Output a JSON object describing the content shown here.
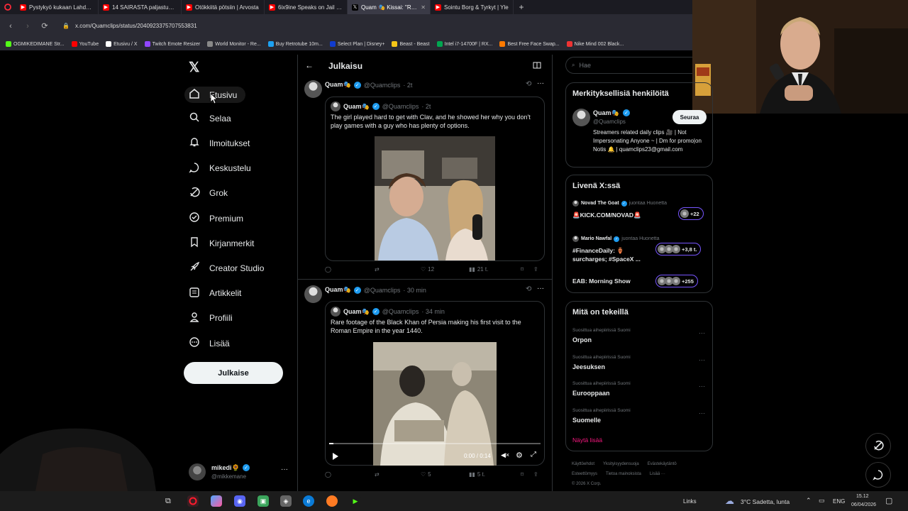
{
  "browser": {
    "tabs": [
      {
        "title": "Pystykyö kukaan Lahdess",
        "color": "#ff0000",
        "icon": "youtube-icon"
      },
      {
        "title": "14 SAIRASTA paljastusta Y",
        "color": "#ff0000",
        "icon": "youtube-icon"
      },
      {
        "title": "Otökkiitä pötsiin | Arvosta",
        "color": "#ff0000",
        "icon": "youtube-icon"
      },
      {
        "title": "6ix9ine Speaks on Jail with",
        "color": "#ff0000",
        "icon": "youtube-icon"
      },
      {
        "title": "Quam 🎭 Kissai: \"Rails",
        "color": "#ffffff",
        "icon": "x-icon"
      },
      {
        "title": "Sointu Borg & Tyrkyt | Yle",
        "color": "#ff0000",
        "icon": "youtube-icon"
      }
    ],
    "url": "x.com/Quamclips/status/2040923375707553831",
    "bookmarks": [
      {
        "label": "OGMIKEDIMANE Str...",
        "color": "#53fc18"
      },
      {
        "label": "YouTube",
        "color": "#ff0000"
      },
      {
        "label": "Etusivu / X",
        "color": "#ffffff"
      },
      {
        "label": "Twitch Emote Resizer",
        "color": "#9146ff"
      },
      {
        "label": "World Monitor - Re...",
        "color": "#888888"
      },
      {
        "label": "Buy Retrotube 10m...",
        "color": "#1da1f2"
      },
      {
        "label": "Select Plan | Disney+",
        "color": "#113ccf"
      },
      {
        "label": "Beast - Beast",
        "color": "#f5c518"
      },
      {
        "label": "Intel i7-14700F | RX...",
        "color": "#00a650"
      },
      {
        "label": "Best Free Face Swap...",
        "color": "#ff7a00"
      },
      {
        "label": "Nike Mind 002 Black...",
        "color": "#ee3333"
      }
    ]
  },
  "nav": {
    "items": [
      {
        "label": "Etusivu",
        "icon": "home-icon"
      },
      {
        "label": "Selaa",
        "icon": "search-icon"
      },
      {
        "label": "Ilmoitukset",
        "icon": "bell-icon"
      },
      {
        "label": "Keskustelu",
        "icon": "chat-icon"
      },
      {
        "label": "Grok",
        "icon": "grok-icon"
      },
      {
        "label": "Premium",
        "icon": "premium-icon"
      },
      {
        "label": "Kirjanmerkit",
        "icon": "bookmark-icon"
      },
      {
        "label": "Creator Studio",
        "icon": "rocket-icon"
      },
      {
        "label": "Artikkelit",
        "icon": "article-icon"
      },
      {
        "label": "Profiili",
        "icon": "profile-icon"
      },
      {
        "label": "Lisää",
        "icon": "more-circle-icon"
      }
    ],
    "compose": "Julkaise",
    "account": {
      "name": "mikedi🌻",
      "handle": "@mikkemane"
    }
  },
  "center": {
    "header": "Julkaisu",
    "tweets": [
      {
        "name": "Quam🎭",
        "handle": "@Quamclips",
        "time": "· 2t",
        "quote": {
          "name": "Quam🎭",
          "handle": "@Quamclips",
          "time": "· 2t",
          "text": "The girl played hard to get with Clav, and he showed her why you don't play games with a guy who has plenty of options."
        },
        "likes": "12",
        "views": "21 t."
      },
      {
        "name": "Quam🎭",
        "handle": "@Quamclips",
        "time": "· 30 min",
        "quote": {
          "name": "Quam🎭",
          "handle": "@Quamclips",
          "time": "· 34 min",
          "text": "Rare footage of the Black Khan of Persia making his first visit to the Roman Empire in the year 1440.",
          "video_time": "0:00 / 0:14",
          "progress": 0.02
        },
        "likes": "5",
        "views": "5 t."
      }
    ]
  },
  "right": {
    "search_placeholder": "Hae",
    "who": {
      "title": "Merkityksellisiä henkilöitä",
      "name": "Quam🎭",
      "handle": "@Quamclips",
      "follow": "Seuraa",
      "bio": "Streamers related daily clips 🎥 | Not Impersonating Anyone ~ | Dm for promo|on Notis 🔔 | quamclips23@gmail.com"
    },
    "live": {
      "title": "Livenä X:ssä",
      "items": [
        {
          "host": "Novad The Goat",
          "status": "juontaa Huonetta",
          "text": "🚨KICK.COM/NOVAD🚨",
          "count": "+22"
        },
        {
          "host": "Mario Nawfal",
          "status": "juontaa Huonetta",
          "text": "#FinanceDaily: 🏺 surcharges; #SpaceX ...",
          "count": "+3,8 t."
        },
        {
          "host": "",
          "status": "",
          "text": "EAB: Morning Show",
          "count": "+255"
        }
      ]
    },
    "trends": {
      "title": "Mitä on tekeillä",
      "items": [
        {
          "context": "Suosittua aihepiirissä Suomi",
          "name": "Orpon"
        },
        {
          "context": "Suosittua aihepiirissä Suomi",
          "name": "Jeesuksen"
        },
        {
          "context": "Suosittua aihepiirissä Suomi",
          "name": "Eurooppaan"
        },
        {
          "context": "Suosittua aihepiirissä Suomi",
          "name": "Suomelle"
        }
      ],
      "show_more": "Näytä lisää"
    },
    "footer": [
      "Käyttöehdot",
      "Yksityisyydensuoja",
      "Evästekäytäntö",
      "Esteettömyys",
      "Tietoa mainoksista",
      "Lisää ···",
      "© 2026 X Corp."
    ]
  },
  "taskbar": {
    "links": "Links",
    "weather": "3°C  Sadetta, lunta",
    "lang": "ENG",
    "time": "15.12",
    "date": "06/04/2026"
  }
}
